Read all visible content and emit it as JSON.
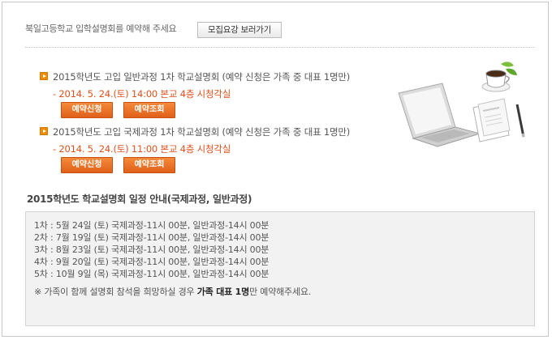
{
  "header": {
    "text": "북일고등학교 입학설명회를 예약해 주세요",
    "guide_button": "모집요강 보러가기"
  },
  "sessions": [
    {
      "title": "2015학년도 고입 일반과정 1차 학교설명회 (예약 신청은 가족 중 대표 1명만)",
      "date": "- 2014. 5. 24.(토) 14:00 본교 4층 시청각실",
      "reserve_label": "예약신청",
      "check_label": "예약조회"
    },
    {
      "title": "2015학년도 고입 국제과정 1차 학교설명회 (예약 신청은 가족 중 대표 1명만)",
      "date": "- 2014. 5. 24.(토) 11:00 본교 4층 시청각실",
      "reserve_label": "예약신청",
      "check_label": "예약조회"
    }
  ],
  "schedule": {
    "title": "2015학년도 학교설명회 일정 안내(국제과정, 일반과정)",
    "items": [
      "1차 : 5월 24일 (토) 국제과정-11시 00분, 일반과정-14시 00분",
      "2차 : 7월 19일 (토) 국제과정-11시 00분, 일반과정-14시 00분",
      "3차 : 8월 23일 (토) 국제과정-11시 00분, 일반과정-14시 00분",
      "4차 : 9월 20일 (토) 국제과정-11시 00분, 일반과정-14시 00분",
      "5차 : 10월 9일 (목) 국제과정-11시 00분, 일반과정-14시 00분"
    ],
    "note_prefix": "※ 가족이 함께 설명회 참석을 희망하실 경우 ",
    "note_bold": "가족 대표 1명",
    "note_suffix": "만 예약해주세요."
  },
  "colors": {
    "accent": "#f08c00",
    "date_text": "#e0501c",
    "button": "#e8702a"
  },
  "icons": {
    "bullet": "orange-arrow-bullet-icon",
    "illustration": "laptop-coffee-documents-illustration"
  }
}
